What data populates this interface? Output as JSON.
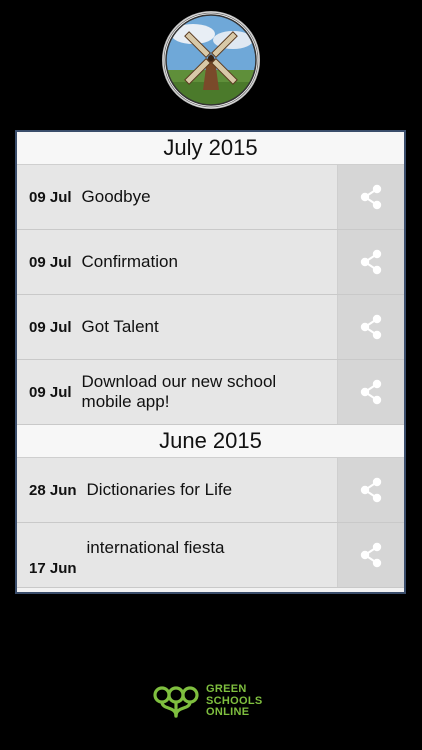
{
  "logo": {
    "icon": "windmill-logo-icon"
  },
  "sections": [
    {
      "month": "July 2015",
      "items": [
        {
          "date": "09 Jul",
          "title": "Goodbye"
        },
        {
          "date": "09 Jul",
          "title": "Confirmation"
        },
        {
          "date": "09 Jul",
          "title": "Got Talent"
        },
        {
          "date": "09 Jul",
          "title": "Download our new school mobile app!"
        }
      ]
    },
    {
      "month": "June 2015",
      "items": [
        {
          "date": "28 Jun",
          "title": "Dictionaries for Life"
        },
        {
          "date": "17 Jun",
          "title": "international fiesta"
        }
      ]
    }
  ],
  "footer": {
    "line1": "GREEN",
    "line2": "SCHOOLS",
    "line3": "ONLINE",
    "icon": "green-schools-logo-icon",
    "color": "#7fbf3f"
  },
  "colors": {
    "background": "#000000",
    "panel_border": "#3a4d6b",
    "row": "#e6e6e6",
    "share_bg": "#d6d6d6",
    "share_icon": "#ffffff"
  },
  "icons": {
    "share": "share-icon"
  }
}
